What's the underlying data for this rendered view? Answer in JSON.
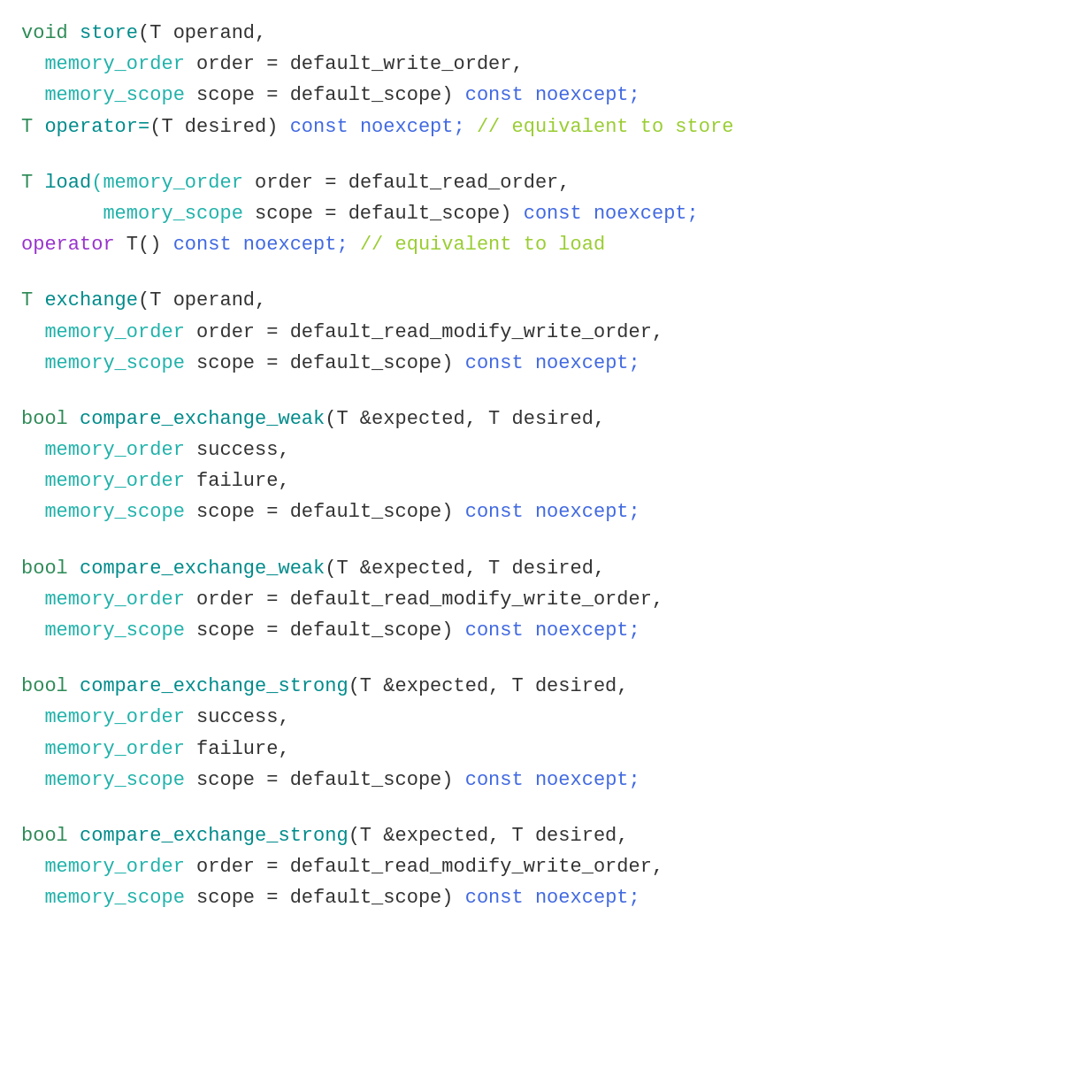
{
  "code": {
    "sections": [
      {
        "id": "store",
        "lines": [
          {
            "tokens": [
              {
                "text": "void ",
                "class": "ret-type"
              },
              {
                "text": "store",
                "class": "func-name"
              },
              {
                "text": "(T operand,",
                "class": "punct"
              }
            ]
          },
          {
            "tokens": [
              {
                "text": "  memory_order",
                "class": "mem-type"
              },
              {
                "text": " order = default_write_order,",
                "class": "punct"
              }
            ]
          },
          {
            "tokens": [
              {
                "text": "  memory_scope",
                "class": "mem-type"
              },
              {
                "text": " scope = default_scope) ",
                "class": "punct"
              },
              {
                "text": "const ",
                "class": "const-kw"
              },
              {
                "text": "noexcept;",
                "class": "const-kw"
              }
            ]
          },
          {
            "tokens": [
              {
                "text": "T ",
                "class": "ret-type"
              },
              {
                "text": "operator=",
                "class": "func-name"
              },
              {
                "text": "(T desired) ",
                "class": "punct"
              },
              {
                "text": "const ",
                "class": "const-kw"
              },
              {
                "text": "noexcept; ",
                "class": "const-kw"
              },
              {
                "text": "// equivalent to store",
                "class": "comment"
              }
            ]
          }
        ]
      },
      {
        "id": "load",
        "lines": [
          {
            "tokens": [
              {
                "text": "T ",
                "class": "ret-type"
              },
              {
                "text": "load",
                "class": "func-name"
              },
              {
                "text": "(memory_order",
                "class": "mem-type"
              },
              {
                "text": " order = default_read_order,",
                "class": "punct"
              }
            ]
          },
          {
            "tokens": [
              {
                "text": "       memory_scope",
                "class": "mem-type"
              },
              {
                "text": " scope = default_scope) ",
                "class": "punct"
              },
              {
                "text": "const ",
                "class": "const-kw"
              },
              {
                "text": "noexcept;",
                "class": "const-kw"
              }
            ]
          },
          {
            "tokens": [
              {
                "text": "operator",
                "class": "operator-kw"
              },
              {
                "text": " T() ",
                "class": "punct"
              },
              {
                "text": "const ",
                "class": "const-kw"
              },
              {
                "text": "noexcept; ",
                "class": "const-kw"
              },
              {
                "text": "// equivalent to load",
                "class": "comment"
              }
            ]
          }
        ]
      },
      {
        "id": "exchange",
        "lines": [
          {
            "tokens": [
              {
                "text": "T ",
                "class": "ret-type"
              },
              {
                "text": "exchange",
                "class": "func-name"
              },
              {
                "text": "(T operand,",
                "class": "punct"
              }
            ]
          },
          {
            "tokens": [
              {
                "text": "  memory_order",
                "class": "mem-type"
              },
              {
                "text": " order = default_read_modify_write_order,",
                "class": "punct"
              }
            ]
          },
          {
            "tokens": [
              {
                "text": "  memory_scope",
                "class": "mem-type"
              },
              {
                "text": " scope = default_scope) ",
                "class": "punct"
              },
              {
                "text": "const ",
                "class": "const-kw"
              },
              {
                "text": "noexcept;",
                "class": "const-kw"
              }
            ]
          }
        ]
      },
      {
        "id": "compare_exchange_weak_1",
        "lines": [
          {
            "tokens": [
              {
                "text": "bool ",
                "class": "ret-type"
              },
              {
                "text": "compare_exchange_weak",
                "class": "func-name"
              },
              {
                "text": "(T &expected, T desired,",
                "class": "punct"
              }
            ]
          },
          {
            "tokens": [
              {
                "text": "  memory_order",
                "class": "mem-type"
              },
              {
                "text": " success,",
                "class": "punct"
              }
            ]
          },
          {
            "tokens": [
              {
                "text": "  memory_order",
                "class": "mem-type"
              },
              {
                "text": " failure,",
                "class": "punct"
              }
            ]
          },
          {
            "tokens": [
              {
                "text": "  memory_scope",
                "class": "mem-type"
              },
              {
                "text": " scope = default_scope) ",
                "class": "punct"
              },
              {
                "text": "const ",
                "class": "const-kw"
              },
              {
                "text": "noexcept;",
                "class": "const-kw"
              }
            ]
          }
        ]
      },
      {
        "id": "compare_exchange_weak_2",
        "lines": [
          {
            "tokens": [
              {
                "text": "bool ",
                "class": "ret-type"
              },
              {
                "text": "compare_exchange_weak",
                "class": "func-name"
              },
              {
                "text": "(T &expected, T desired,",
                "class": "punct"
              }
            ]
          },
          {
            "tokens": [
              {
                "text": "  memory_order",
                "class": "mem-type"
              },
              {
                "text": " order = default_read_modify_write_order,",
                "class": "punct"
              }
            ]
          },
          {
            "tokens": [
              {
                "text": "  memory_scope",
                "class": "mem-type"
              },
              {
                "text": " scope = default_scope) ",
                "class": "punct"
              },
              {
                "text": "const ",
                "class": "const-kw"
              },
              {
                "text": "noexcept;",
                "class": "const-kw"
              }
            ]
          }
        ]
      },
      {
        "id": "compare_exchange_strong_1",
        "lines": [
          {
            "tokens": [
              {
                "text": "bool ",
                "class": "ret-type"
              },
              {
                "text": "compare_exchange_strong",
                "class": "func-name"
              },
              {
                "text": "(T &expected, T desired,",
                "class": "punct"
              }
            ]
          },
          {
            "tokens": [
              {
                "text": "  memory_order",
                "class": "mem-type"
              },
              {
                "text": " success,",
                "class": "punct"
              }
            ]
          },
          {
            "tokens": [
              {
                "text": "  memory_order",
                "class": "mem-type"
              },
              {
                "text": " failure,",
                "class": "punct"
              }
            ]
          },
          {
            "tokens": [
              {
                "text": "  memory_scope",
                "class": "mem-type"
              },
              {
                "text": " scope = default_scope) ",
                "class": "punct"
              },
              {
                "text": "const ",
                "class": "const-kw"
              },
              {
                "text": "noexcept;",
                "class": "const-kw"
              }
            ]
          }
        ]
      },
      {
        "id": "compare_exchange_strong_2",
        "lines": [
          {
            "tokens": [
              {
                "text": "bool ",
                "class": "ret-type"
              },
              {
                "text": "compare_exchange_strong",
                "class": "func-name"
              },
              {
                "text": "(T &expected, T desired,",
                "class": "punct"
              }
            ]
          },
          {
            "tokens": [
              {
                "text": "  memory_order",
                "class": "mem-type"
              },
              {
                "text": " order = default_read_modify_write_order,",
                "class": "punct"
              }
            ]
          },
          {
            "tokens": [
              {
                "text": "  memory_scope",
                "class": "mem-type"
              },
              {
                "text": " scope = default_scope) ",
                "class": "punct"
              },
              {
                "text": "const ",
                "class": "const-kw"
              },
              {
                "text": "noexcept;",
                "class": "const-kw"
              }
            ]
          }
        ]
      }
    ]
  }
}
